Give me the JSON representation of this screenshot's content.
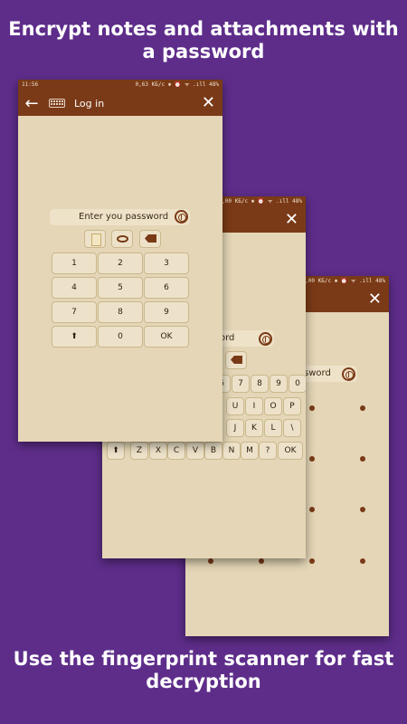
{
  "headline_top": "Encrypt notes and attachments with a password",
  "headline_bottom": "Use the fingerprint scanner for fast decryption",
  "colors": {
    "background": "#5e2d8a",
    "appbar": "#7a3a17",
    "screen": "#e4d6b6",
    "key": "#ede2c9"
  },
  "front_phone": {
    "status_time": "11:56",
    "status_right": "0,63 КБ/с ✱ ⏰ ᯤ .ıll 48%",
    "appbar_title": "Log in",
    "back_icon": "arrow-left",
    "close_icon": "close",
    "password_placeholder": "Enter you password",
    "keys": [
      "1",
      "2",
      "3",
      "4",
      "5",
      "6",
      "7",
      "8",
      "9",
      "⬆",
      "0",
      "OK"
    ]
  },
  "middle_phone": {
    "status_right": "0,00 КБ/с ✱ ⏰ ᯤ .ıll 48%",
    "password_fragment": "ord",
    "keyboard": {
      "row_numbers": [
        "6",
        "7",
        "8",
        "9",
        "0"
      ],
      "row1": [
        "U",
        "I",
        "O",
        "P"
      ],
      "row2": [
        "J",
        "K",
        "L",
        "\\"
      ],
      "row3": [
        "⬆",
        "Z",
        "X",
        "C",
        "V",
        "B",
        "N",
        "M",
        "?",
        "OK"
      ]
    }
  },
  "back_phone": {
    "status_right": "0,00 КБ/с ✱ ⏰ ᯤ .ıll 48%",
    "password_fragment": "sword"
  }
}
